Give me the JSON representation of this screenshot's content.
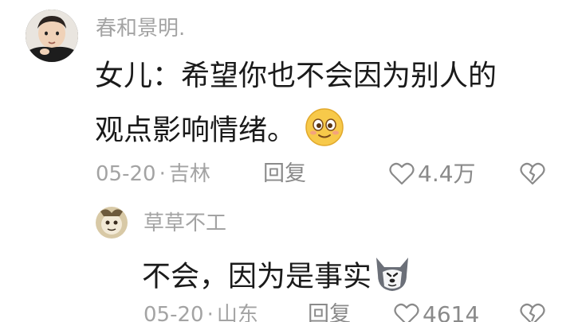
{
  "comments": [
    {
      "username": "春和景明.",
      "line1": "女儿：希望你也不会因为别人的",
      "line2": "观点影响情绪。",
      "emoji_icon": "smile-emoji-icon",
      "date": "05-20",
      "location": "吉林",
      "reply_label": "回复",
      "likes": "4.4万"
    },
    {
      "username": "草草不工",
      "text": "不会，因为是事实",
      "emoji_icon": "husky-dog-emoji-icon",
      "date": "05-20",
      "location": "山东",
      "reply_label": "回复",
      "likes": "4614"
    }
  ],
  "separator": "·",
  "colors": {
    "meta": "#a3a3a3",
    "text": "#1a1a1a",
    "icon": "#8a8a8a"
  }
}
